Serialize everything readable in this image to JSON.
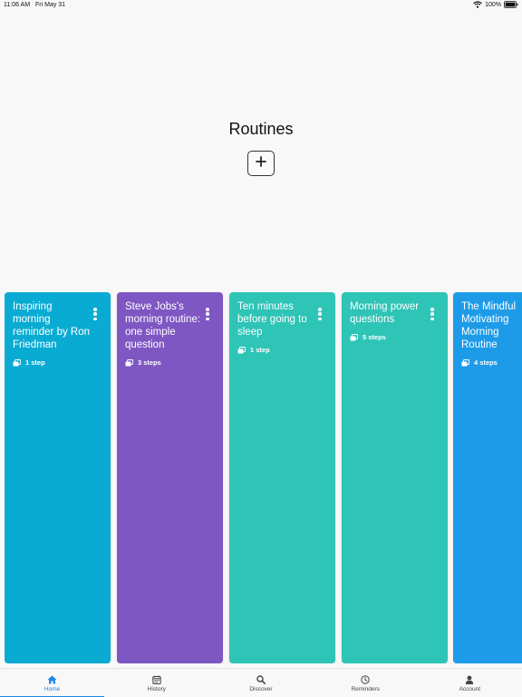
{
  "status_bar": {
    "time": "11:06 AM",
    "date": "Fri May 31",
    "battery": "100%"
  },
  "header": {
    "title": "Routines",
    "add_button_icon": "plus-icon"
  },
  "routines": [
    {
      "title": "Inspiring morning reminder by Ron Friedman",
      "steps": "1 step",
      "color": "#0aabd3"
    },
    {
      "title": "Steve Jobs's morning routine: one simple question",
      "steps": "3 steps",
      "color": "#7e57c2"
    },
    {
      "title": "Ten minutes before going to sleep",
      "steps": "1 step",
      "color": "#2ec4b6"
    },
    {
      "title": "Morning power questions",
      "steps": "5 steps",
      "color": "#2ec4b6"
    },
    {
      "title": "The Mindful Motivating Morning Routine",
      "steps": "4 steps",
      "color": "#1e9be8"
    }
  ],
  "tabs": [
    {
      "label": "Home",
      "icon": "home-icon",
      "active": true
    },
    {
      "label": "History",
      "icon": "calendar-icon",
      "active": false
    },
    {
      "label": "Discover",
      "icon": "search-icon",
      "active": false
    },
    {
      "label": "Reminders",
      "icon": "clock-icon",
      "active": false
    },
    {
      "label": "Account",
      "icon": "person-icon",
      "active": false
    }
  ],
  "colors": {
    "accent": "#1e88e5",
    "background": "#f8f8f8"
  }
}
